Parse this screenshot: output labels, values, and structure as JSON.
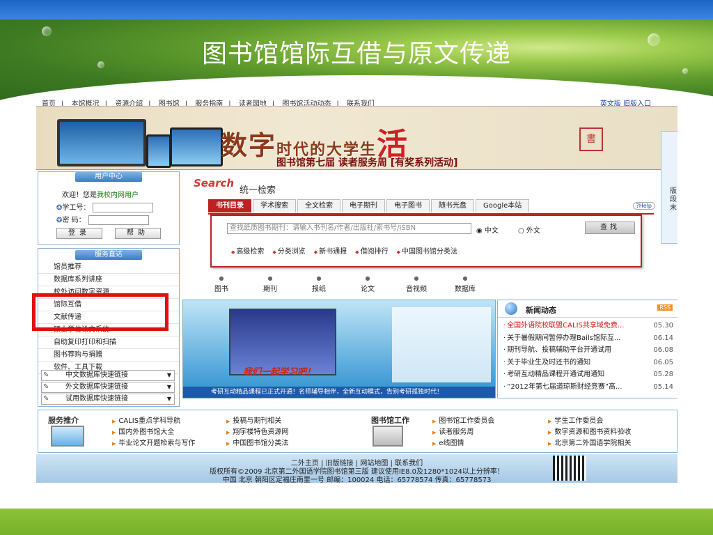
{
  "slide": {
    "title": "图书馆馆际互借与原文传递"
  },
  "site": {
    "nav": [
      "首页",
      "本馆概况",
      "资源介绍",
      "图书馆",
      "服务指南",
      "读者园地",
      "图书馆活动动态",
      "联系我们"
    ],
    "nav_right": "英文版 旧版入口",
    "hero": {
      "headline_a": "数字",
      "headline_b": "时代的大学生",
      "headline_c": "活",
      "subtitle": "图书馆第七届 读者服务周 [有奖系列活动]",
      "seal": "書"
    },
    "side_tab_text": [
      "版",
      "段",
      "末"
    ],
    "user_center": {
      "header": "用户中心",
      "welcome_prefix": "欢迎！您是",
      "welcome_user": "我校内网用户",
      "id_label": "学工号：",
      "pwd_label": "密  码：",
      "login": "登录",
      "help": "帮助"
    },
    "services": {
      "header": "服务直达",
      "items": [
        "馆员推荐",
        "数据库系列讲座",
        "校外访问数字资源",
        "馆际互借",
        "文献传递",
        "硕士学位论文系统",
        "自助复印打印和扫描",
        "图书荐购与捐赠",
        "软件、工具下载"
      ],
      "selects": [
        "中文数据库快速链接",
        "外文数据库快速链接",
        "试用数据库快速链接"
      ]
    },
    "search": {
      "logo": "Search",
      "logo_cn": "统一检索",
      "tabs": [
        "书刊目录",
        "学术搜索",
        "全文检索",
        "电子期刊",
        "电子图书",
        "随书光盘",
        "Google本站"
      ],
      "help": "?Help",
      "placeholder": "查找纸质图书期刊：请输入书刊名/作者/出版社/索书号/ISBN",
      "radio_cn": "中文",
      "radio_en": "外文",
      "go": "查找",
      "links": [
        "高级检索",
        "分类浏览",
        "新书通报",
        "借阅排行",
        "中国图书馆分类法"
      ],
      "types": [
        "图书",
        "期刊",
        "报纸",
        "论文",
        "音视频",
        "数据库"
      ]
    },
    "video": {
      "slogan": "我们一起学习吧！",
      "ticker": "考研互动精品课程已正式开通！名师辅导相伴，全新互动模式，告别考研孤独时代！"
    },
    "news": {
      "title": "新闻动态",
      "rss": "RSS",
      "items": [
        {
          "text": "全国外语院校联盟CALIS共享域免费...",
          "date": "05.30",
          "hot": true
        },
        {
          "text": "关于暑假期间暂停办理Bails馆际互...",
          "date": "06.14",
          "hot": false
        },
        {
          "text": "期刊导航、投稿辅助平台开通试用",
          "date": "06.08",
          "hot": false
        },
        {
          "text": "关于毕业生及时还书的通知",
          "date": "06.05",
          "hot": false
        },
        {
          "text": "考研互动精品课程开通试用通知",
          "date": "05.28",
          "hot": false
        },
        {
          "text": "“2012年第七届道琼斯财经竞赛”高...",
          "date": "05.14",
          "hot": false
        }
      ]
    },
    "recommend": {
      "header": "服务推介",
      "links": [
        "CALIS重点学科导航",
        "国内外图书馆大全",
        "毕业论文开题检索与写作",
        "投稿与期刊相关",
        "翔宇楼特色资源网",
        "中国图书馆分类法"
      ]
    },
    "work": {
      "header": "图书馆工作",
      "links": [
        "图书馆工作委员会",
        "读者服务周",
        "e线图情",
        "学生工作委员会",
        "数字资源和图书资料验收",
        "北京第二外国语学院相关"
      ]
    },
    "footer": {
      "line1": "二外主页  |  旧版链接  |  网站地图  |  联系我们",
      "line2": "版权所有©2009 北京第二外国语学院图书馆第三版 建议使用IE8.0及1280*1024以上分辨率！",
      "line3": "中国 北京  朝阳区定福庄南里一号  邮编：100024 电话：65778574 传真：65778573"
    }
  },
  "colors": {
    "top_bar": "#2a74d4",
    "bottom_bar": "#82bb33",
    "highlight_box": "#e01010",
    "tab_active": "#b22222"
  }
}
